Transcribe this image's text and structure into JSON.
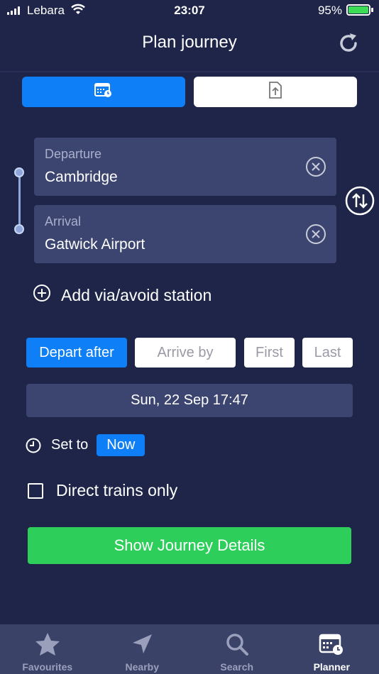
{
  "status_bar": {
    "carrier": "Lebara",
    "time": "23:07",
    "battery": "95%"
  },
  "header": {
    "title": "Plan journey"
  },
  "mode_toggle": {
    "left_icon": "calendar-clock-icon",
    "right_icon": "upload-document-icon"
  },
  "journey": {
    "departure": {
      "label": "Departure",
      "value": "Cambridge"
    },
    "arrival": {
      "label": "Arrival",
      "value": "Gatwick Airport"
    }
  },
  "via": {
    "label": "Add via/avoid station"
  },
  "time_options": {
    "depart_after": "Depart after",
    "arrive_by": "Arrive by",
    "first": "First",
    "last": "Last"
  },
  "datetime": {
    "value": "Sun, 22 Sep 17:47"
  },
  "set_to": {
    "label": "Set to",
    "now": "Now"
  },
  "direct": {
    "label": "Direct trains only"
  },
  "show_button": {
    "label": "Show Journey Details"
  },
  "tabs": [
    {
      "label": "Favourites",
      "icon": "star-icon"
    },
    {
      "label": "Nearby",
      "icon": "location-arrow-icon"
    },
    {
      "label": "Search",
      "icon": "search-icon"
    },
    {
      "label": "Planner",
      "icon": "planner-icon"
    }
  ],
  "colors": {
    "background": "#1e2548",
    "accent": "#0f7ff7",
    "green": "#2dcf5a",
    "field": "#3c4470"
  }
}
